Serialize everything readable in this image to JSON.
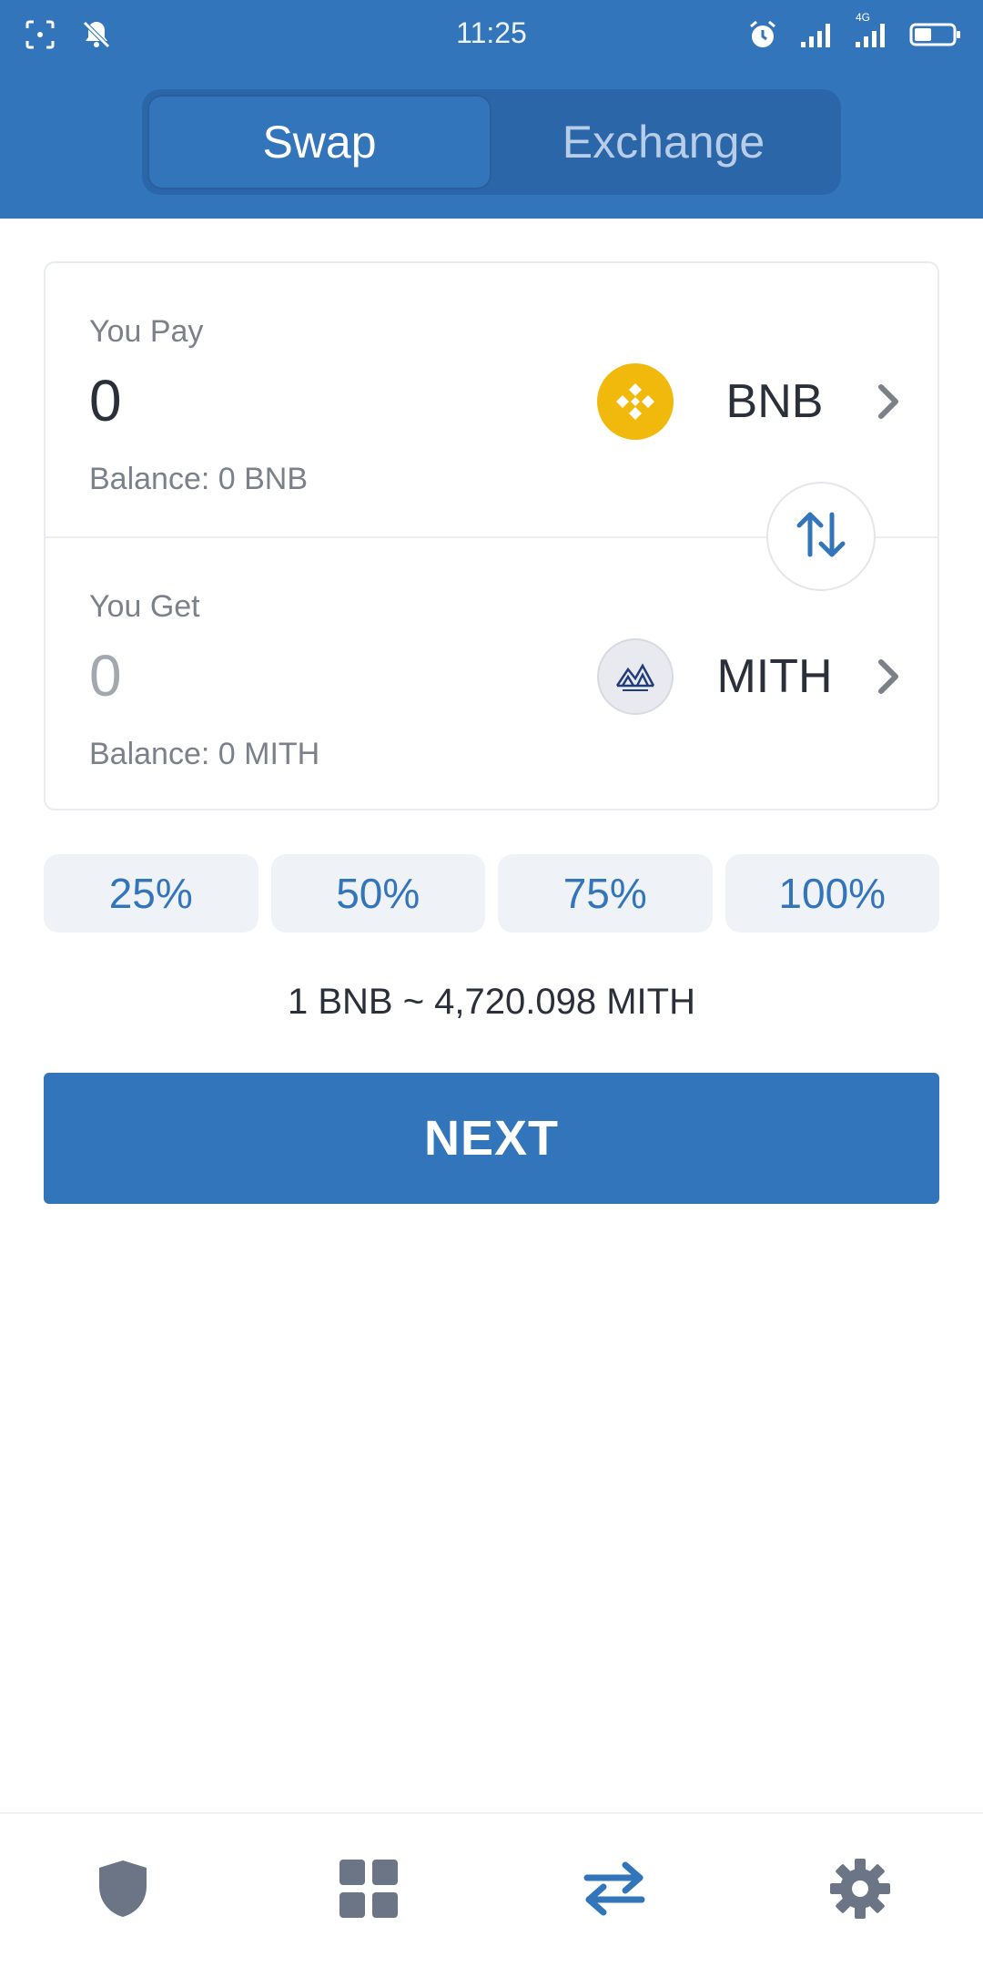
{
  "status_bar": {
    "time": "11:25",
    "left_icons": [
      "screenshot-icon",
      "bell-off-icon"
    ],
    "right_icons": [
      "alarm-icon",
      "signal-icon",
      "signal-4g-icon",
      "battery-icon"
    ],
    "network_label": "4G"
  },
  "tabs": [
    {
      "label": "Swap",
      "active": true
    },
    {
      "label": "Exchange",
      "active": false
    }
  ],
  "pay": {
    "label": "You Pay",
    "amount": "0",
    "balance": "Balance: 0 BNB",
    "token_symbol": "BNB",
    "token_icon": "bnb-logo-icon"
  },
  "get": {
    "label": "You Get",
    "amount": "0",
    "balance": "Balance: 0 MITH",
    "token_symbol": "MITH",
    "token_icon": "mith-logo-icon"
  },
  "percent_buttons": [
    "25%",
    "50%",
    "75%",
    "100%"
  ],
  "rate_text": "1 BNB ~ 4,720.098 MITH",
  "next_button": "NEXT",
  "bottom_nav": [
    {
      "icon": "shield-icon",
      "active": false
    },
    {
      "icon": "grid-icon",
      "active": false
    },
    {
      "icon": "swap-arrows-icon",
      "active": true
    },
    {
      "icon": "gear-icon",
      "active": false
    }
  ],
  "colors": {
    "brand": "#3375bb",
    "header_segment_bg": "#2b66a8",
    "bnb": "#f0b90b",
    "nav_inactive": "#6b7585",
    "percent_bg": "#eff3f8"
  }
}
